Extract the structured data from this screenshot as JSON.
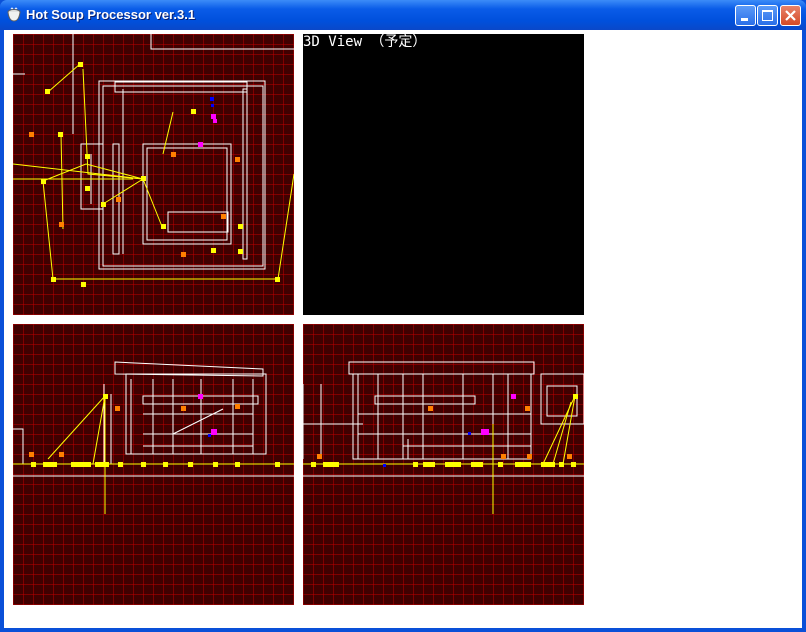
{
  "window": {
    "title": "Hot Soup Processor ver.3.1",
    "icon": "hsp-cup-icon",
    "controls": [
      "minimize",
      "maximize",
      "close"
    ]
  },
  "views": {
    "top": {
      "name": "top-view"
    },
    "view3d": {
      "label": "3D View （予定）"
    },
    "front": {
      "name": "front-view"
    },
    "side": {
      "name": "side-view"
    }
  },
  "colors": {
    "grid_bg": "#400000",
    "grid_line": "#C00000",
    "wire": "#FFFFFF",
    "marker_yellow": "#FFFF00",
    "marker_orange": "#FF8000",
    "marker_magenta": "#FF00FF",
    "marker_blue": "#0000FF",
    "view3d_bg": "#000000"
  }
}
